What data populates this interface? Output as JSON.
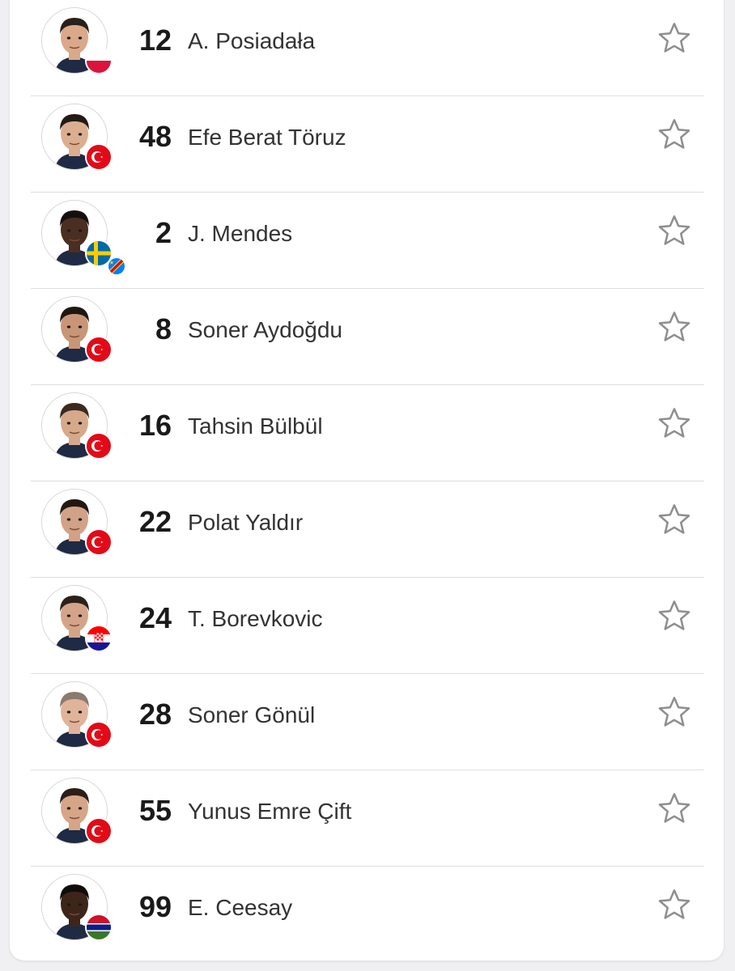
{
  "players": [
    {
      "number": "12",
      "name": "A. Posiadała",
      "flags": [
        "poland"
      ],
      "skin": "#d9a98a",
      "hair": "#2a1f1a"
    },
    {
      "number": "48",
      "name": "Efe Berat Töruz",
      "flags": [
        "turkey"
      ],
      "skin": "#dcae90",
      "hair": "#241a15"
    },
    {
      "number": "2",
      "name": "J. Mendes",
      "flags": [
        "sweden",
        "dr-congo"
      ],
      "skin": "#4a2e22",
      "hair": "#15100d"
    },
    {
      "number": "8",
      "name": "Soner Aydoğdu",
      "flags": [
        "turkey"
      ],
      "skin": "#c99577",
      "hair": "#1f1712"
    },
    {
      "number": "16",
      "name": "Tahsin Bülbül",
      "flags": [
        "turkey"
      ],
      "skin": "#d7a98b",
      "hair": "#3a2a1f"
    },
    {
      "number": "22",
      "name": "Polat Yaldır",
      "flags": [
        "turkey"
      ],
      "skin": "#d2a286",
      "hair": "#221812"
    },
    {
      "number": "24",
      "name": "T. Borevkovic",
      "flags": [
        "croatia"
      ],
      "skin": "#d4a488",
      "hair": "#2b211b"
    },
    {
      "number": "28",
      "name": "Soner Gönül",
      "flags": [
        "turkey"
      ],
      "skin": "#e0b49a",
      "hair": "#8a7a70"
    },
    {
      "number": "55",
      "name": "Yunus Emre Çift",
      "flags": [
        "turkey"
      ],
      "skin": "#d6a587",
      "hair": "#2a1e17"
    },
    {
      "number": "99",
      "name": "E. Ceesay",
      "flags": [
        "gambia"
      ],
      "skin": "#3d2519",
      "hair": "#120c09"
    }
  ],
  "colors": {
    "turkey_red": "#e30a17",
    "poland_red": "#dc143c",
    "star_stroke": "#8e8e8e",
    "divider": "#dedede"
  },
  "icons": {
    "favorite": "star-outline-icon"
  }
}
